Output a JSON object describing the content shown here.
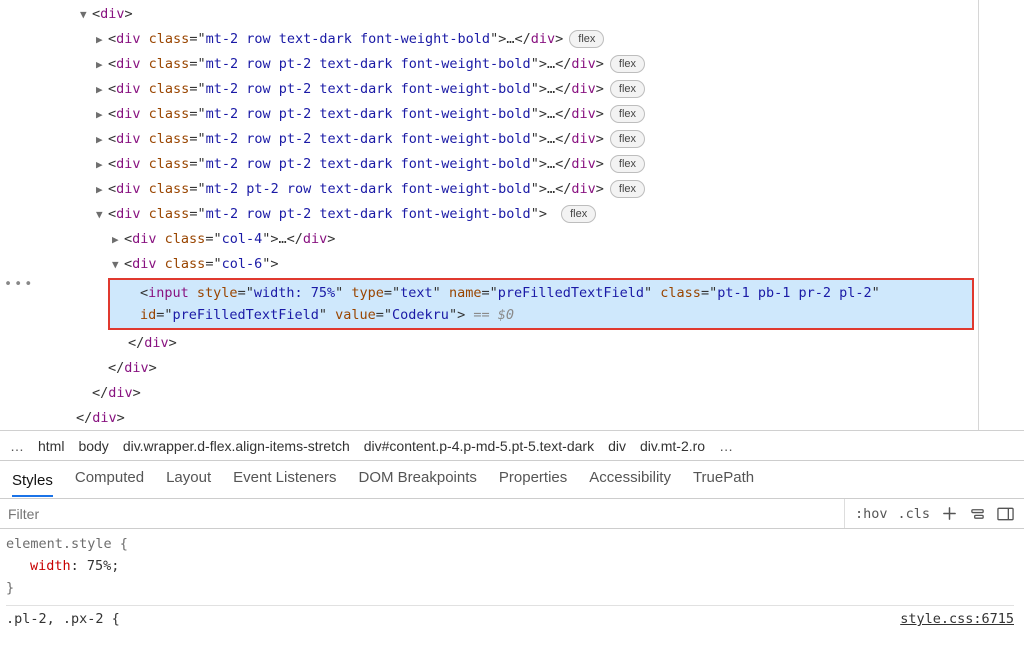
{
  "dom": {
    "root_tag": "div",
    "class_row": "mt-2 row text-dark font-weight-bold",
    "class_row_pt2": "mt-2 row pt-2 text-dark font-weight-bold",
    "class_row_pt2_alt": "mt-2 pt-2 row text-dark font-weight-bold",
    "class_col4": "col-4",
    "class_col6": "col-6",
    "flex_label": "flex",
    "close_div": "div",
    "open_angle": "<",
    "close_angle": ">",
    "close_slash": "</",
    "ellipsis": "…",
    "class_attr_label": " class",
    "equals_quote": "=\"",
    "end_quote": "\""
  },
  "selected": {
    "tag": "input",
    "style_attr": "width: 75%",
    "type_attr": "text",
    "name_attr": "preFilledTextField",
    "class_attr": "pt-1 pb-1 pr-2 pl-2",
    "id_attr": "preFilledTextField",
    "value_attr": "Codekru",
    "eq0": " == $0"
  },
  "breadcrumb": {
    "ell": "…",
    "items": [
      "html",
      "body",
      "div.wrapper.d-flex.align-items-stretch",
      "div#content.p-4.p-md-5.pt-5.text-dark",
      "div",
      "div.mt-2.ro"
    ]
  },
  "tabs": [
    "Styles",
    "Computed",
    "Layout",
    "Event Listeners",
    "DOM Breakpoints",
    "Properties",
    "Accessibility",
    "TruePath"
  ],
  "filter": {
    "placeholder": "Filter",
    "hov": ":hov",
    "cls": ".cls"
  },
  "styles": {
    "element_style_selector": "element.style {",
    "width_prop": "width",
    "width_val": "75%",
    "close_brace": "}",
    "rule2_selector": ".pl-2, .px-2 {",
    "source_link": "style.css:6715"
  }
}
